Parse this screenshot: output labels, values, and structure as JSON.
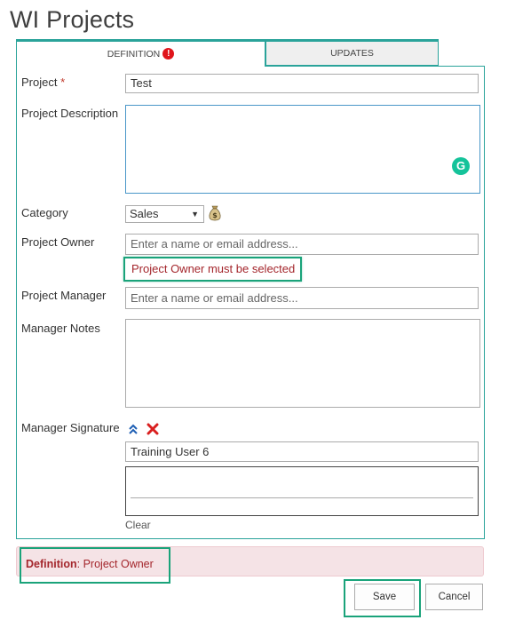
{
  "page": {
    "title": "WI Projects"
  },
  "tabs": [
    {
      "label": "DEFINITION",
      "error_badge": "!"
    },
    {
      "label": "UPDATES"
    }
  ],
  "form": {
    "project": {
      "label": "Project",
      "required_marker": "*",
      "value": "Test"
    },
    "project_description": {
      "label": "Project Description",
      "grammarly_glyph": "G"
    },
    "category": {
      "label": "Category",
      "value": "Sales",
      "icon": "money-bag-icon"
    },
    "project_owner": {
      "label": "Project Owner",
      "placeholder": "Enter a name or email address...",
      "error": "Project Owner must be selected"
    },
    "project_manager": {
      "label": "Project Manager",
      "placeholder": "Enter a name or email address..."
    },
    "manager_notes": {
      "label": "Manager Notes"
    },
    "manager_signature": {
      "label": "Manager Signature",
      "signer": "Training User 6",
      "clear_label": "Clear"
    }
  },
  "validation_summary": {
    "field_bold": "Definition",
    "separator": ":",
    "message": " Project Owner"
  },
  "actions": {
    "save_label": "Save",
    "cancel_label": "Cancel"
  },
  "colors": {
    "accent": "#2aa39a",
    "error": "#a4262c",
    "highlight": "#1aa37a",
    "summary_bg": "#f5e3e6"
  }
}
